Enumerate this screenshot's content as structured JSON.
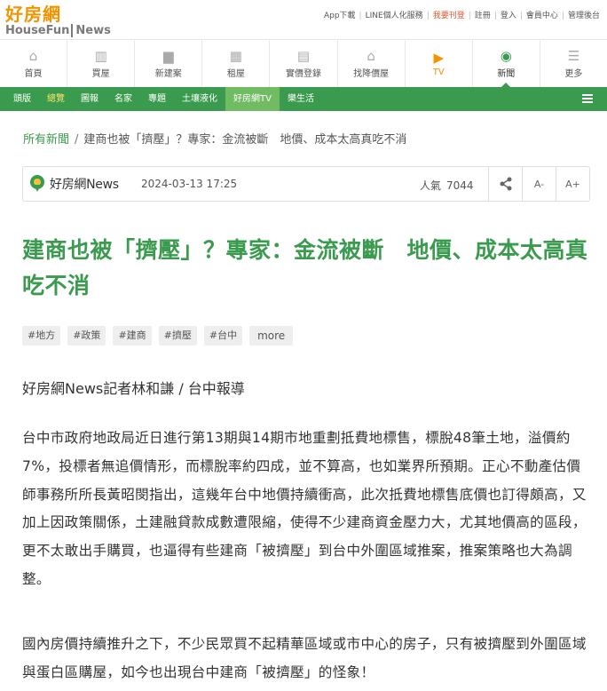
{
  "logo": {
    "cn": "好房網",
    "en": "HouseFun",
    "en_news": "News"
  },
  "toplinks": [
    {
      "label": "App下載",
      "highlight": false
    },
    {
      "label": "LINE個人化服務",
      "highlight": false
    },
    {
      "label": "我要刊登",
      "highlight": true
    },
    {
      "label": "註冊",
      "highlight": false
    },
    {
      "label": "登入",
      "highlight": false
    },
    {
      "label": "會員中心",
      "highlight": false
    },
    {
      "label": "管理後台",
      "highlight": false
    }
  ],
  "mainnav": [
    {
      "label": "首頁",
      "icon": "home-icon",
      "glyph": "⌂"
    },
    {
      "label": "買屋",
      "icon": "buy-house-icon",
      "glyph": "▥"
    },
    {
      "label": "新建案",
      "icon": "buildings-icon",
      "glyph": "▆"
    },
    {
      "label": "租屋",
      "icon": "rent-building-icon",
      "glyph": "▦"
    },
    {
      "label": "實價登錄",
      "icon": "price-register-icon",
      "glyph": "▤"
    },
    {
      "label": "找降價屋",
      "icon": "price-drop-house-icon",
      "glyph": "⌂"
    },
    {
      "label": "TV",
      "icon": "play-icon",
      "glyph": "▶"
    },
    {
      "label": "新聞",
      "icon": "rss-icon",
      "glyph": "◉"
    },
    {
      "label": "更多",
      "icon": "more-lines-icon",
      "glyph": "☰"
    }
  ],
  "subnav": [
    {
      "label": "頭版",
      "state": "normal"
    },
    {
      "label": "總覽",
      "state": "active"
    },
    {
      "label": "圖報",
      "state": "normal"
    },
    {
      "label": "名家",
      "state": "normal"
    },
    {
      "label": "專題",
      "state": "normal"
    },
    {
      "label": "土壤液化",
      "state": "normal"
    },
    {
      "label": "好房網TV",
      "state": "tv"
    },
    {
      "label": "樂生活",
      "state": "normal"
    }
  ],
  "breadcrumb": {
    "home": "所有新聞",
    "separator": "/",
    "current": "建商也被「擠壓」？專家：金流被斷　地價、成本太高真吃不消"
  },
  "meta": {
    "source": "好房網News",
    "date": "2024-03-13 17:25",
    "views_label": "人氣",
    "views": "7044",
    "font_minus": "A-",
    "font_plus": "A+"
  },
  "article": {
    "title": "建商也被「擠壓」？專家：金流被斷　地價、成本太高真吃不消",
    "tags": [
      "#地方",
      "#政策",
      "#建商",
      "#擠壓",
      "#台中"
    ],
    "tags_more": "more",
    "byline": "好房網News記者林和謙 / 台中報導",
    "paragraphs": [
      "台中市政府地政局近日進行第13期與14期市地重劃抵費地標售，標脫48筆土地，溢價約7%，投標者無追價情形，而標脫率約四成，並不算高，也如業界所預期。正心不動產估價師事務所所長黃昭閔指出，這幾年台中地價持續衝高，此次抵費地標售底價也訂得頗高，又加上因政策關係，土建融貸款成數遭限縮，使得不少建商資金壓力大，尤其地價高的區段，更不太敢出手購買，也逼得有些建商「被擠壓」到台中外圍區域推案，推案策略也大為調整。",
      "國內房價持續推升之下，不少民眾買不起精華區域或市中心的房子，只有被擠壓到外圍區域與蛋白區購屋，如今也出現台中建商「被擠壓」的怪象！"
    ]
  },
  "colors": {
    "brand_green": "#3a9b4f",
    "brand_orange": "#f29400",
    "subnav_tv": "#71bb62",
    "active_tab": "#ffe46a"
  }
}
